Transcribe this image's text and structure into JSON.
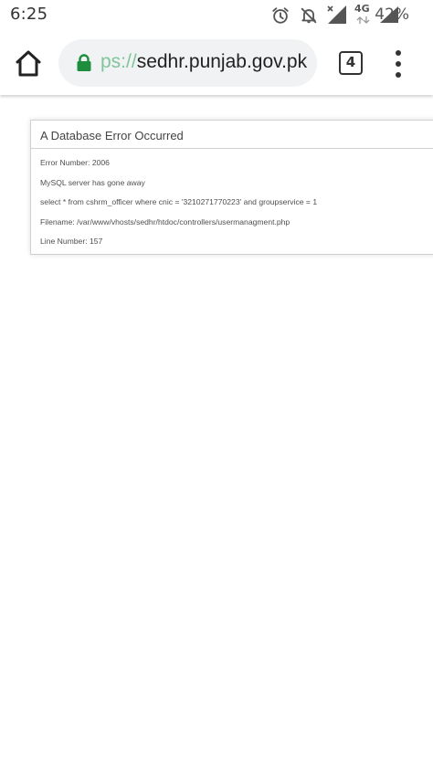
{
  "status_bar": {
    "time": "6:25",
    "battery": "42%",
    "network": "4G"
  },
  "toolbar": {
    "url_scheme": "ps://",
    "url_host": "sedhr.punjab.gov.pk",
    "tab_count": "4",
    "icons": [
      "home-icon",
      "lock-icon",
      "tabs-icon",
      "more-vert-icon"
    ]
  },
  "error": {
    "title": "A Database Error Occurred",
    "lines": [
      "Error Number: 2006",
      "MySQL server has gone away",
      "select * from cshrm_officer where cnic = '3210271770223' and groupservice = 1",
      "Filename: /var/www/vhosts/sedhr/htdoc/controllers/usermanagment.php",
      "Line Number: 157"
    ]
  },
  "colors": {
    "lock": "#1e8e3e",
    "scheme": "#7fc59a",
    "url_bar_bg": "#f1f2f3"
  }
}
